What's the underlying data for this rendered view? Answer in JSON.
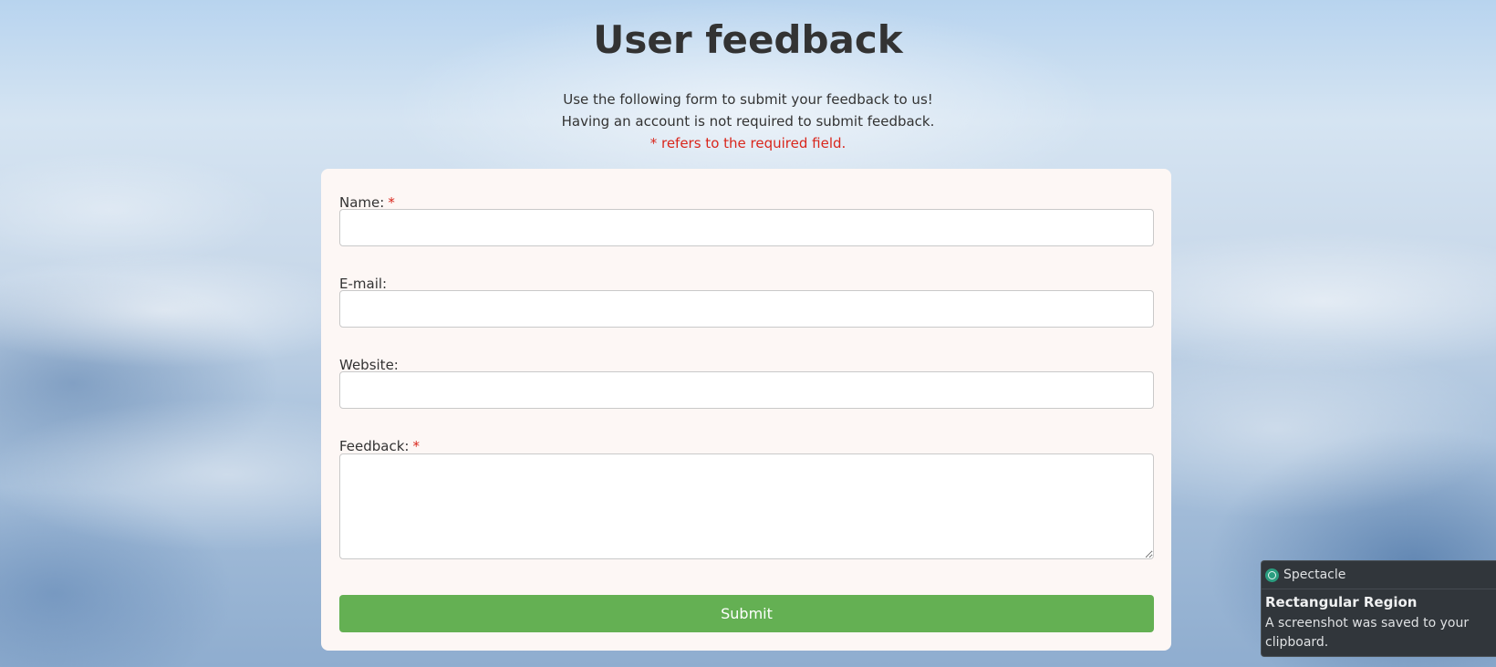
{
  "page": {
    "title": "User feedback",
    "intro_line1": "Use the following form to submit your feedback to us!",
    "intro_line2": "Having an account is not required to submit feedback.",
    "required_note": "* refers to the required field."
  },
  "form": {
    "name": {
      "label": "Name:",
      "required_mark": "*",
      "value": ""
    },
    "email": {
      "label": "E-mail:",
      "value": ""
    },
    "website": {
      "label": "Website:",
      "value": ""
    },
    "feedback": {
      "label": "Feedback:",
      "required_mark": "*",
      "value": ""
    },
    "submit_label": "Submit"
  },
  "notification": {
    "app_name": "Spectacle",
    "app_icon": "spectacle-icon",
    "title": "Rectangular Region",
    "body": "A screenshot was saved to your clipboard."
  },
  "colors": {
    "required": "#d9261c",
    "submit_button": "#64b053",
    "card_background": "#fdf7f5",
    "text": "#333333"
  }
}
